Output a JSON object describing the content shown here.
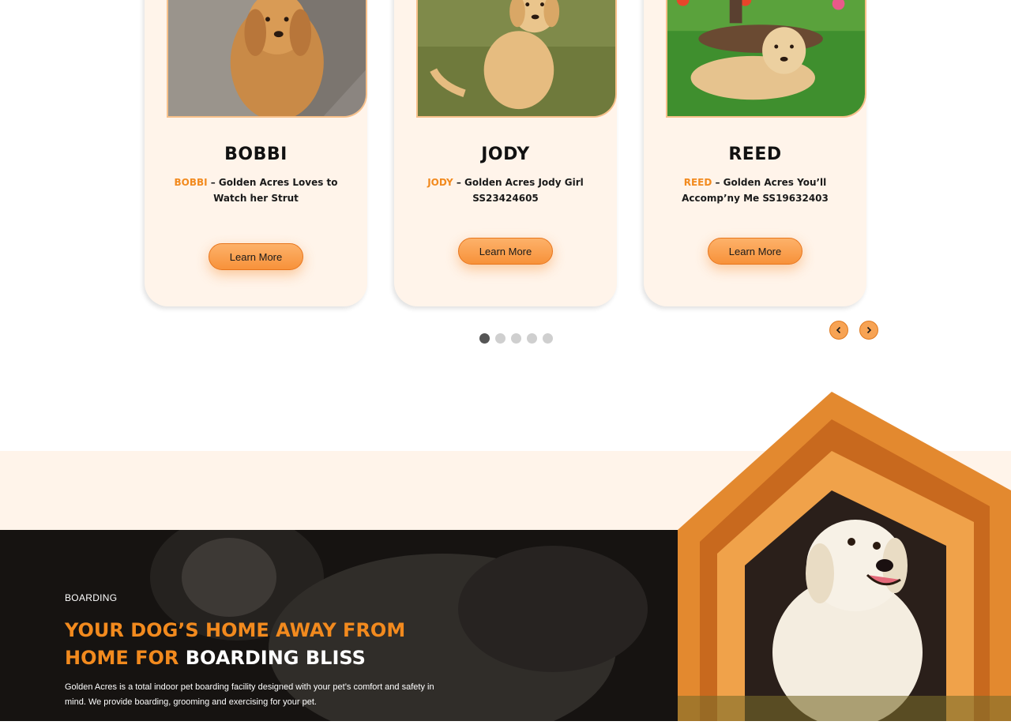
{
  "cards": [
    {
      "name": "BOBBI",
      "desc_highlight": "BOBBI",
      "desc_rest": " – Golden Acres Loves to Watch her Strut",
      "button": "Learn More"
    },
    {
      "name": "JODY",
      "desc_highlight": "JODY",
      "desc_rest": " – Golden Acres Jody Girl SS23424605",
      "button": "Learn More"
    },
    {
      "name": "REED",
      "desc_highlight": "REED",
      "desc_rest": " – Golden Acres You’ll Accomp’ny Me SS19632403",
      "button": "Learn More"
    }
  ],
  "carousel": {
    "active_dot": 1,
    "dot_count": 5
  },
  "icons": {
    "prev": "chevron-left-icon",
    "next": "chevron-right-icon"
  },
  "boarding": {
    "label": "BOARDING",
    "title_orange": "YOUR DOG’S HOME AWAY FROM HOME FOR ",
    "title_white": "BOARDING BLISS",
    "text": "Golden Acres is a total indoor pet boarding facility designed with your pet’s comfort and safety in mind. We provide boarding, grooming and exercising for your pet."
  },
  "colors": {
    "accent": "#f28a1e",
    "card_bg": "#fff4ea",
    "dark": "#1c1a18"
  }
}
